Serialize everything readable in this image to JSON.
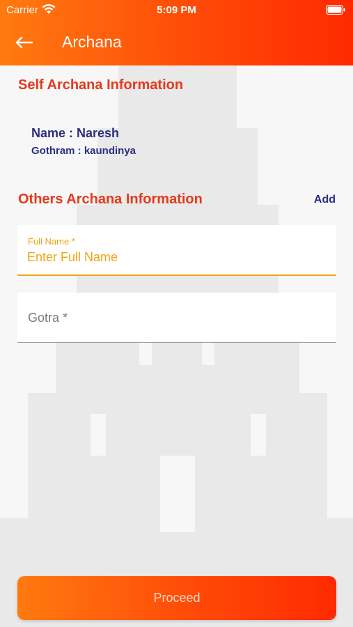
{
  "status_bar": {
    "carrier": "Carrier",
    "time": "5:09 PM"
  },
  "nav": {
    "title": "Archana",
    "back_icon": "back-arrow-icon"
  },
  "self_section": {
    "title": "Self Archana Information",
    "name_line": "Name : Naresh",
    "gothram_line": "Gothram : kaundinya"
  },
  "others_section": {
    "title": "Others Archana Information",
    "add_label": "Add"
  },
  "form": {
    "full_name": {
      "label": "Full Name *",
      "placeholder": "Enter Full Name",
      "value": ""
    },
    "gotra": {
      "placeholder": "Gotra *",
      "value": ""
    }
  },
  "actions": {
    "proceed_label": "Proceed"
  },
  "colors": {
    "accent_orange": "#ff5a0a",
    "section_title_red": "#e43a1b",
    "info_navy": "#2c2f7f",
    "focus_amber": "#f2a414"
  }
}
